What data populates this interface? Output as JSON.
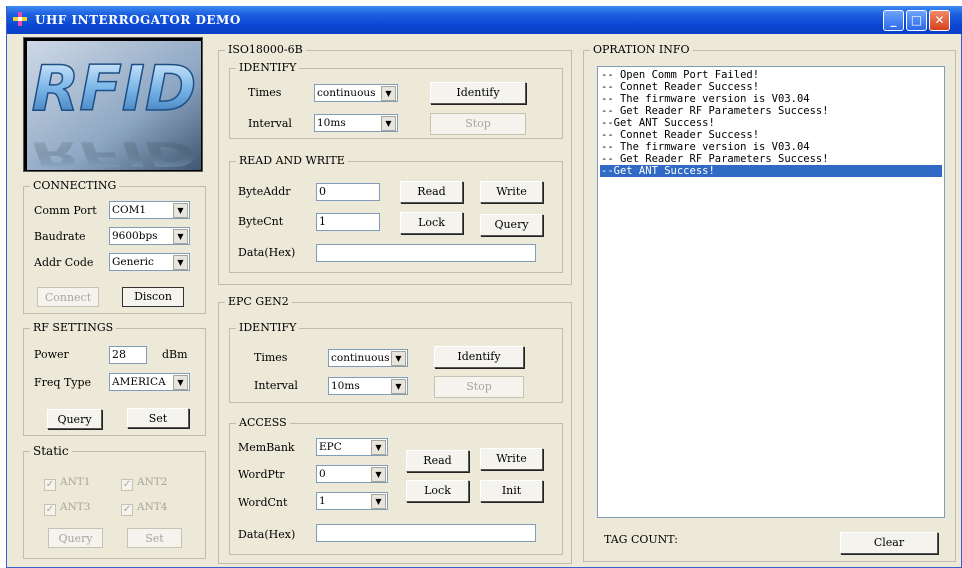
{
  "window": {
    "title": "UHF INTERROGATOR DEMO",
    "controls": [
      "minimize-icon",
      "maximize-icon",
      "close-icon"
    ],
    "accent": "#0a46d4"
  },
  "logo": {
    "text": "RFID"
  },
  "connecting": {
    "legend": "CONNECTING",
    "comm_port_label": "Comm Port",
    "comm_port_value": "COM1",
    "baudrate_label": "Baudrate",
    "baudrate_value": "9600bps",
    "addr_code_label": "Addr Code",
    "addr_code_value": "Generic",
    "connect_label": "Connect",
    "discon_label": "Discon"
  },
  "rf_settings": {
    "legend": "RF SETTINGS",
    "power_label": "Power",
    "power_value": "28",
    "power_unit": "dBm",
    "freq_type_label": "Freq Type",
    "freq_type_value": "AMERICA",
    "query_label": "Query",
    "set_label": "Set"
  },
  "static": {
    "legend": "Static",
    "ant1": "ANT1",
    "ant2": "ANT2",
    "ant3": "ANT3",
    "ant4": "ANT4",
    "query_label": "Query",
    "set_label": "Set"
  },
  "iso": {
    "legend": "ISO18000-6B",
    "identify": {
      "legend": "IDENTIFY",
      "times_label": "Times",
      "times_value": "continuous",
      "interval_label": "Interval",
      "interval_value": "10ms",
      "identify_label": "Identify",
      "stop_label": "Stop"
    },
    "read_write": {
      "legend": "READ AND WRITE",
      "byteaddr_label": "ByteAddr",
      "byteaddr_value": "0",
      "bytecnt_label": "ByteCnt",
      "bytecnt_value": "1",
      "data_label": "Data(Hex)",
      "data_value": "",
      "read_label": "Read",
      "write_label": "Write",
      "lock_label": "Lock",
      "query_label": "Query"
    }
  },
  "epc": {
    "legend": "EPC GEN2",
    "identify": {
      "legend": "IDENTIFY",
      "times_label": "Times",
      "times_value": "continuous",
      "interval_label": "Interval",
      "interval_value": "10ms",
      "identify_label": "Identify",
      "stop_label": "Stop"
    },
    "access": {
      "legend": "ACCESS",
      "membank_label": "MemBank",
      "membank_value": "EPC",
      "wordptr_label": "WordPtr",
      "wordptr_value": "0",
      "wordcnt_label": "WordCnt",
      "wordcnt_value": "1",
      "data_label": "Data(Hex)",
      "data_value": "",
      "read_label": "Read",
      "write_label": "Write",
      "lock_label": "Lock",
      "init_label": "Init"
    }
  },
  "info": {
    "legend": "OPRATION INFO",
    "lines": [
      "-- Open Comm Port Failed!",
      "-- Connet Reader Success!",
      "-- The firmware version is V03.04",
      "-- Get Reader RF Parameters Success!",
      "--Get ANT Success!",
      "-- Connet Reader Success!",
      "-- The firmware version is V03.04",
      "-- Get Reader RF Parameters Success!",
      "--Get ANT Success!"
    ],
    "selected_index": 8,
    "tag_count_label": "TAG COUNT:",
    "tag_count_value": "",
    "clear_label": "Clear"
  }
}
